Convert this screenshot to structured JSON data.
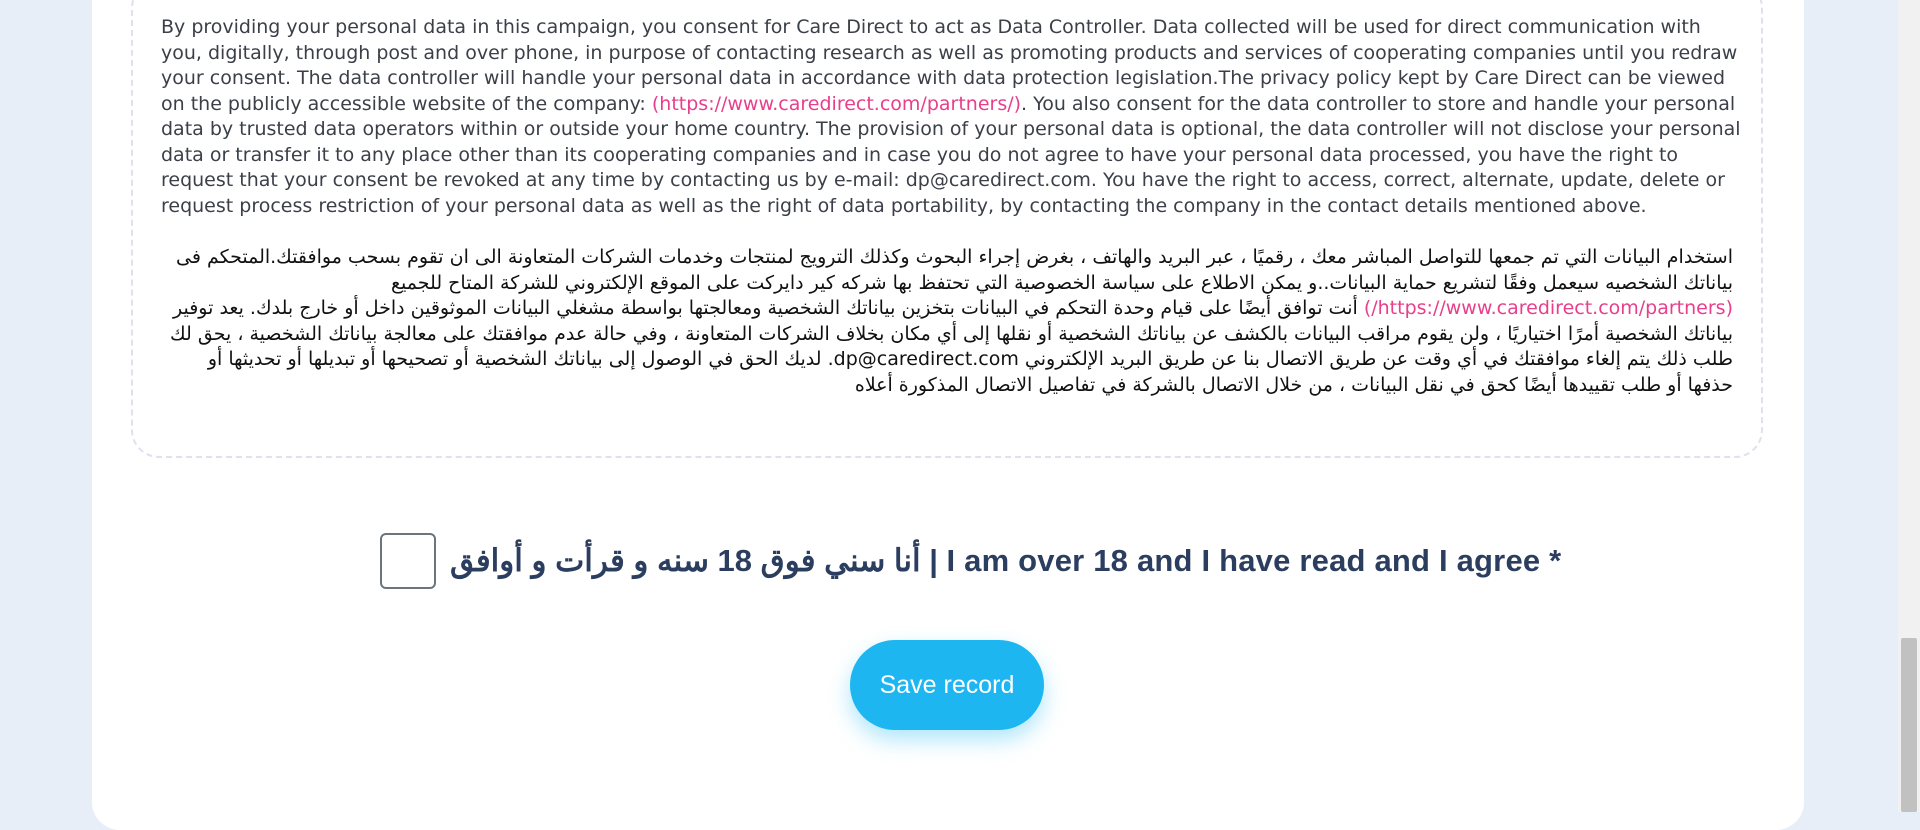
{
  "consent": {
    "en_part1": "By providing your personal data in this campaign, you consent for Care Direct to act as Data Controller. Data collected will be used for direct communication with you, digitally, through post and over phone, in purpose of contacting research as well as promoting products and services of cooperating companies until you redraw your consent. The data controller will handle your personal data in accordance with data protection legislation.The privacy policy kept by Care Direct can be viewed on the publicly accessible website of the company: ",
    "en_link": "(https://www.caredirect.com/partners/)",
    "en_part2": ". You also consent for the data controller to store and handle your personal data by trusted data operators within or outside your home country. The provision of your personal data is optional, the data controller will not disclose your personal data or transfer it to any place other than its cooperating companies and in case you do not agree to have your personal data processed, you have the right to request that your consent be revoked at any time by contacting us by e-mail: dp@caredirect.com. You have the right to access, correct, alternate, update, delete or request process restriction of your personal data as well as the right of data portability, by contacting the company in the contact details mentioned above.",
    "ar_part1": "استخدام البيانات التي تم جمعها للتواصل المباشر معك ، رقميًا ، عبر البريد والهاتف ، بغرض إجراء البحوث وكذلك الترويج لمنتجات وخدمات الشركات المتعاونة الى ان تقوم بسحب موافقتك.المتحكم فى بياناتك الشخصيه سيعمل وفقًا لتشريع حماية البيانات..و يمكن الاطلاع على سياسة الخصوصية التي تحتفظ بها شركه كير دايركت على الموقع الإلكتروني للشركة المتاح للجميع ",
    "ar_link": "(https://www.caredirect.com/partners/)",
    "ar_part2": " أنت توافق أيضًا على قيام وحدة التحكم في البيانات بتخزين بياناتك الشخصية ومعالجتها بواسطة مشغلي البيانات الموثوقين داخل أو خارج بلدك. يعد توفير بياناتك الشخصية أمرًا اختياريًا ، ولن يقوم مراقب البيانات بالكشف عن بياناتك الشخصية أو نقلها إلى أي مكان بخلاف الشركات المتعاونة ، وفي حالة عدم موافقتك على معالجة بياناتك الشخصية ، يحق لك طلب ذلك يتم إلغاء موافقتك في أي وقت عن طريق الاتصال بنا عن طريق البريد الإلكتروني dp@caredirect.com. لديك الحق في الوصول إلى بياناتك الشخصية أو تصحيحها أو تبديلها أو تحديثها أو حذفها أو طلب تقييدها أيضًا كحق في نقل البيانات ، من خلال الاتصال بالشركة في تفاصيل الاتصال المذكورة أعلاه"
  },
  "agree": {
    "label": "أنا سني فوق 18 سنه و قرأت و أوافق  | I am over 18 and I have read and I agree *"
  },
  "save_button": {
    "label": "Save record"
  }
}
